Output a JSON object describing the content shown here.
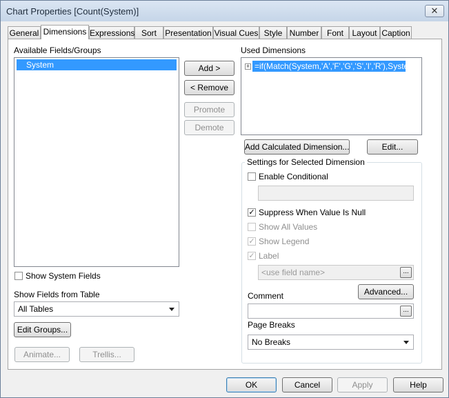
{
  "window": {
    "title": "Chart Properties [Count(System)]",
    "close_glyph": "✕"
  },
  "tabs": [
    {
      "label": "General"
    },
    {
      "label": "Dimensions",
      "active": true
    },
    {
      "label": "Expressions"
    },
    {
      "label": "Sort"
    },
    {
      "label": "Presentation"
    },
    {
      "label": "Visual Cues"
    },
    {
      "label": "Style"
    },
    {
      "label": "Number"
    },
    {
      "label": "Font"
    },
    {
      "label": "Layout"
    },
    {
      "label": "Caption"
    }
  ],
  "available": {
    "label": "Available Fields/Groups",
    "items": [
      "System"
    ]
  },
  "show_system_fields": {
    "label": "Show System Fields",
    "checked": false
  },
  "show_fields_from_table": {
    "label": "Show Fields from Table",
    "value": "All Tables"
  },
  "buttons": {
    "add": "Add >",
    "remove": "< Remove",
    "promote": "Promote",
    "demote": "Demote",
    "edit_groups": "Edit Groups...",
    "animate": "Animate...",
    "trellis": "Trellis...",
    "add_calculated": "Add Calculated Dimension...",
    "edit": "Edit...",
    "advanced": "Advanced...",
    "ellipsis": "...",
    "ok": "OK",
    "cancel": "Cancel",
    "apply": "Apply",
    "help": "Help"
  },
  "used": {
    "label": "Used Dimensions",
    "items": [
      "=if(Match(System,'A','F','G','S','I','R'),System)"
    ]
  },
  "settings": {
    "title": "Settings for Selected Dimension",
    "enable_conditional": {
      "label": "Enable Conditional",
      "checked": false
    },
    "suppress_null": {
      "label": "Suppress When Value Is Null",
      "checked": true
    },
    "show_all_values": {
      "label": "Show All Values",
      "checked": false
    },
    "show_legend": {
      "label": "Show Legend",
      "checked": true
    },
    "label": {
      "label": "Label",
      "checked": true,
      "placeholder": "<use field name>"
    },
    "comment_label": "Comment",
    "page_breaks": {
      "label": "Page Breaks",
      "value": "No Breaks"
    }
  },
  "colors": {
    "selection": "#3399ff",
    "titlebar": "#c5d5e8"
  }
}
